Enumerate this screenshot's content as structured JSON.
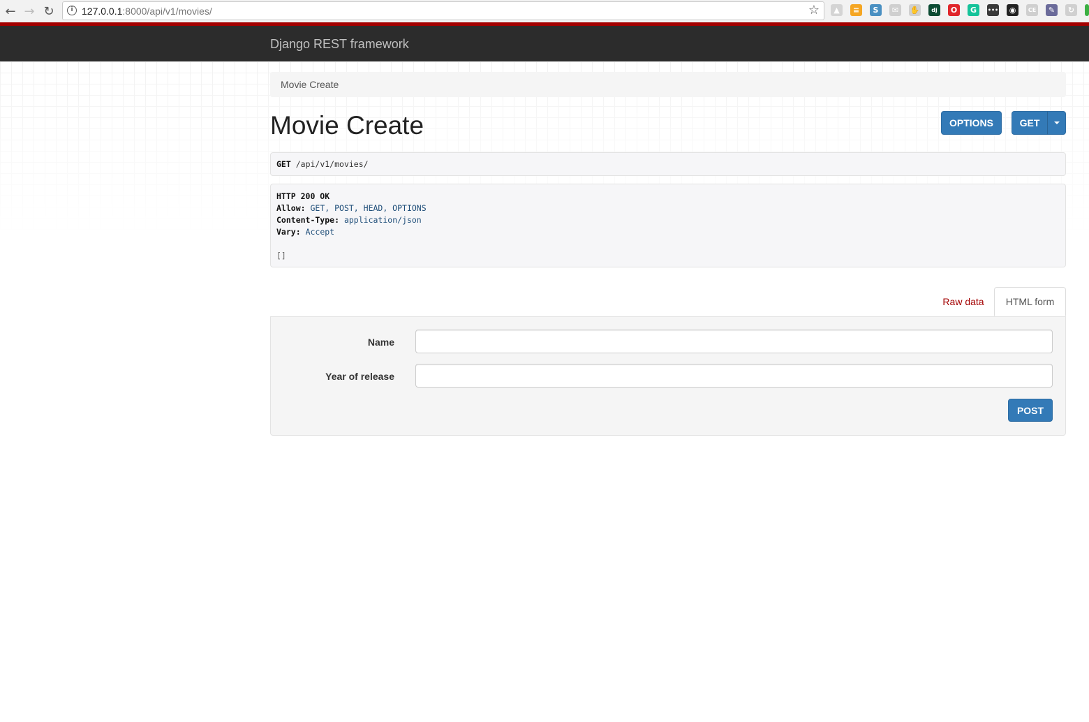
{
  "browser": {
    "url_host": "127.0.0.1",
    "url_rest": ":8000/api/v1/movies/",
    "extensions": [
      {
        "name": "drive-icon",
        "color": "#d4d4d4",
        "glyph": "▲"
      },
      {
        "name": "calculator-icon",
        "color": "#f5a623",
        "glyph": "≡"
      },
      {
        "name": "s-extension-icon",
        "color": "#4a90c2",
        "glyph": "S"
      },
      {
        "name": "mail-icon",
        "color": "#cfcfcf",
        "glyph": "✉"
      },
      {
        "name": "hand-icon",
        "color": "#d0d0d0",
        "glyph": "✋"
      },
      {
        "name": "django-icon",
        "color": "#0c4b33",
        "glyph": "dj"
      },
      {
        "name": "opera-icon",
        "color": "#e0262b",
        "glyph": "O"
      },
      {
        "name": "grammarly-icon",
        "color": "#15c39a",
        "glyph": "G"
      },
      {
        "name": "dots-icon",
        "color": "#3a3a3a",
        "glyph": "•••"
      },
      {
        "name": "color-wheel-icon",
        "color": "#222222",
        "glyph": "◉"
      },
      {
        "name": "ce-icon",
        "color": "#cfcfcf",
        "glyph": "CE"
      },
      {
        "name": "eyedropper-icon",
        "color": "#6b6b9a",
        "glyph": "✎"
      },
      {
        "name": "refresh-ext-icon",
        "color": "#d0d0d0",
        "glyph": "↻"
      },
      {
        "name": "green-ext-icon",
        "color": "#3cb043",
        "glyph": " "
      }
    ]
  },
  "navbar": {
    "brand": "Django REST framework"
  },
  "breadcrumb": {
    "current": "Movie Create"
  },
  "page": {
    "title": "Movie Create",
    "options_label": "OPTIONS",
    "get_label": "GET"
  },
  "request": {
    "method": "GET",
    "path": "/api/v1/movies/"
  },
  "response": {
    "status": "HTTP 200 OK",
    "headers": [
      {
        "key": "Allow:",
        "value": "GET, POST, HEAD, OPTIONS"
      },
      {
        "key": "Content-Type:",
        "value": "application/json"
      },
      {
        "key": "Vary:",
        "value": "Accept"
      }
    ],
    "body": "[]"
  },
  "tabs": {
    "raw": "Raw data",
    "html": "HTML form"
  },
  "form": {
    "name_label": "Name",
    "name_value": "",
    "year_label": "Year of release",
    "year_value": "",
    "submit_label": "POST"
  },
  "colors": {
    "primary": "#337ab7",
    "navbar_bg": "#2c2c2c",
    "navbar_accent": "#a30000",
    "link_red": "#a30000"
  }
}
